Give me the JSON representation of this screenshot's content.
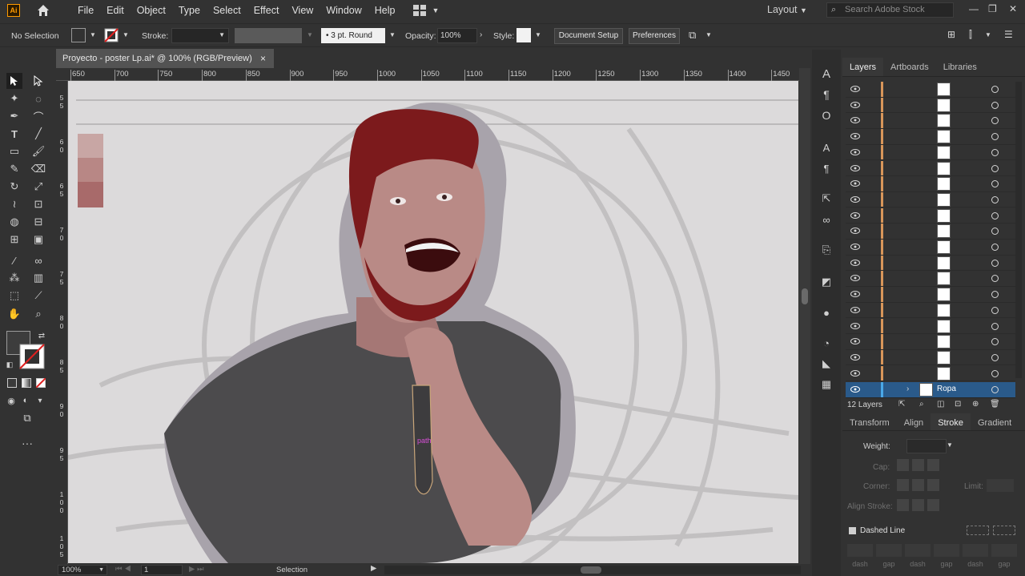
{
  "menubar": {
    "logo": "Ai",
    "items": [
      "File",
      "Edit",
      "Object",
      "Type",
      "Select",
      "Effect",
      "View",
      "Window",
      "Help"
    ],
    "workspace": "Layout",
    "search_placeholder": "Search Adobe Stock"
  },
  "control": {
    "selection": "No Selection",
    "stroke_label": "Stroke:",
    "brush": "3 pt. Round",
    "opacity_label": "Opacity:",
    "opacity_value": "100%",
    "style_label": "Style:",
    "doc_setup": "Document Setup",
    "preferences": "Preferences"
  },
  "document": {
    "tab_title": "Proyecto - poster Lp.ai* @ 100% (RGB/Preview)",
    "close": "×"
  },
  "ruler": {
    "top": [
      "650",
      "700",
      "750",
      "800",
      "850",
      "900",
      "950",
      "1000",
      "1050",
      "1100",
      "1150",
      "1200",
      "1250",
      "1300",
      "1350",
      "1400",
      "1450"
    ],
    "left": [
      [
        "5",
        "5"
      ],
      [
        "6",
        "0"
      ],
      [
        "6",
        "5"
      ],
      [
        "7",
        "0"
      ],
      [
        "7",
        "5"
      ],
      [
        "8",
        "0"
      ],
      [
        "8",
        "5"
      ],
      [
        "9",
        "0"
      ],
      [
        "9",
        "5"
      ],
      [
        "1",
        "0",
        "0"
      ],
      [
        "1",
        "0",
        "5"
      ]
    ]
  },
  "canvas": {
    "path_label": "path",
    "swatch_colors": [
      "#c8a6a4",
      "#b88785",
      "#a86a6a"
    ]
  },
  "status": {
    "zoom": "100%",
    "artboard": "1",
    "mode": "Selection"
  },
  "layers": {
    "tabs": [
      "Layers",
      "Artboards",
      "Libraries"
    ],
    "active_layer": "Ropa",
    "count": "12 Layers"
  },
  "stroke_panel": {
    "tabs": [
      "Transform",
      "Align",
      "Stroke",
      "Gradient"
    ],
    "weight_label": "Weight:",
    "cap_label": "Cap:",
    "corner_label": "Corner:",
    "limit_label": "Limit:",
    "align_label": "Align Stroke:",
    "dashed_line": "Dashed Line",
    "dash_labels": [
      "dash",
      "gap",
      "dash",
      "gap",
      "dash",
      "gap"
    ]
  },
  "colors": {
    "accent": "#d8965a",
    "selection_blue": "#2a5a8a",
    "path_magenta": "#d94fd8"
  }
}
